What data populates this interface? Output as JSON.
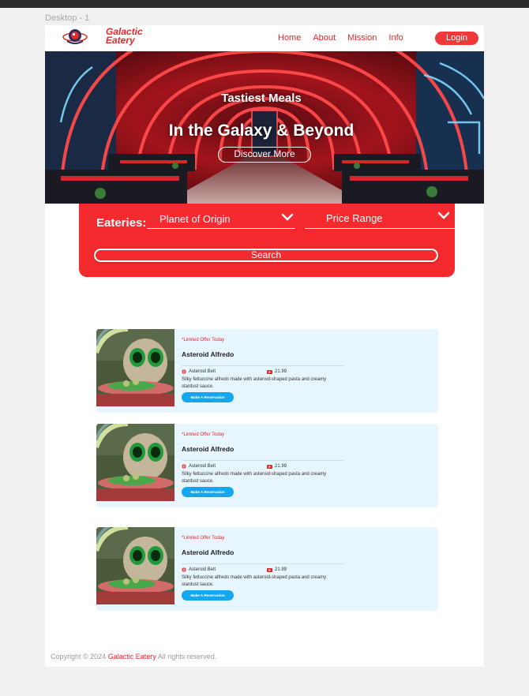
{
  "frame_label": "Desktop - 1",
  "brand": {
    "line1": "Galactic",
    "line2": "Eatery"
  },
  "nav": {
    "links": [
      "Home",
      "About",
      "Mission",
      "Info"
    ],
    "login": "Login"
  },
  "hero": {
    "subtitle": "Tastiest Meals",
    "title": "In the Galaxy & Beyond",
    "cta": "Discover More"
  },
  "search": {
    "label": "Eateries:",
    "planet_select": "Planet of Origin",
    "price_select": "Price Range",
    "button": "Search"
  },
  "cards": [
    {
      "offer": "*Limited Offer Today",
      "title": "Asteroid Alfredo",
      "location": "Asteroid Belt",
      "price": "21.99",
      "description": "Silky fettuccine alfredo made with asteroid-shaped pasta and creamy stardust sauce.",
      "button": "Make A Reservation"
    },
    {
      "offer": "*Limited Offer Today",
      "title": "Asteroid Alfredo",
      "location": "Asteroid Belt",
      "price": "21.99",
      "description": "Silky fettuccine alfredo made with asteroid-shaped pasta and creamy stardust sauce.",
      "button": "Make A Reservation"
    },
    {
      "offer": "*Limited Offer Today",
      "title": "Asteroid Alfredo",
      "location": "Asteroid Belt",
      "price": "21.99",
      "description": "Silky fettuccine alfredo made with asteroid-shaped pasta and creamy stardust sauce.",
      "button": "Make A Reservation"
    }
  ],
  "footer": {
    "prefix": "Copyright © 2024 ",
    "brand": "Galactic Eatery",
    "suffix": " All rights reserved."
  },
  "colors": {
    "accent": "#f52a2e",
    "button_blue": "#14a7ee",
    "card_bg": "#e7f6fd"
  }
}
